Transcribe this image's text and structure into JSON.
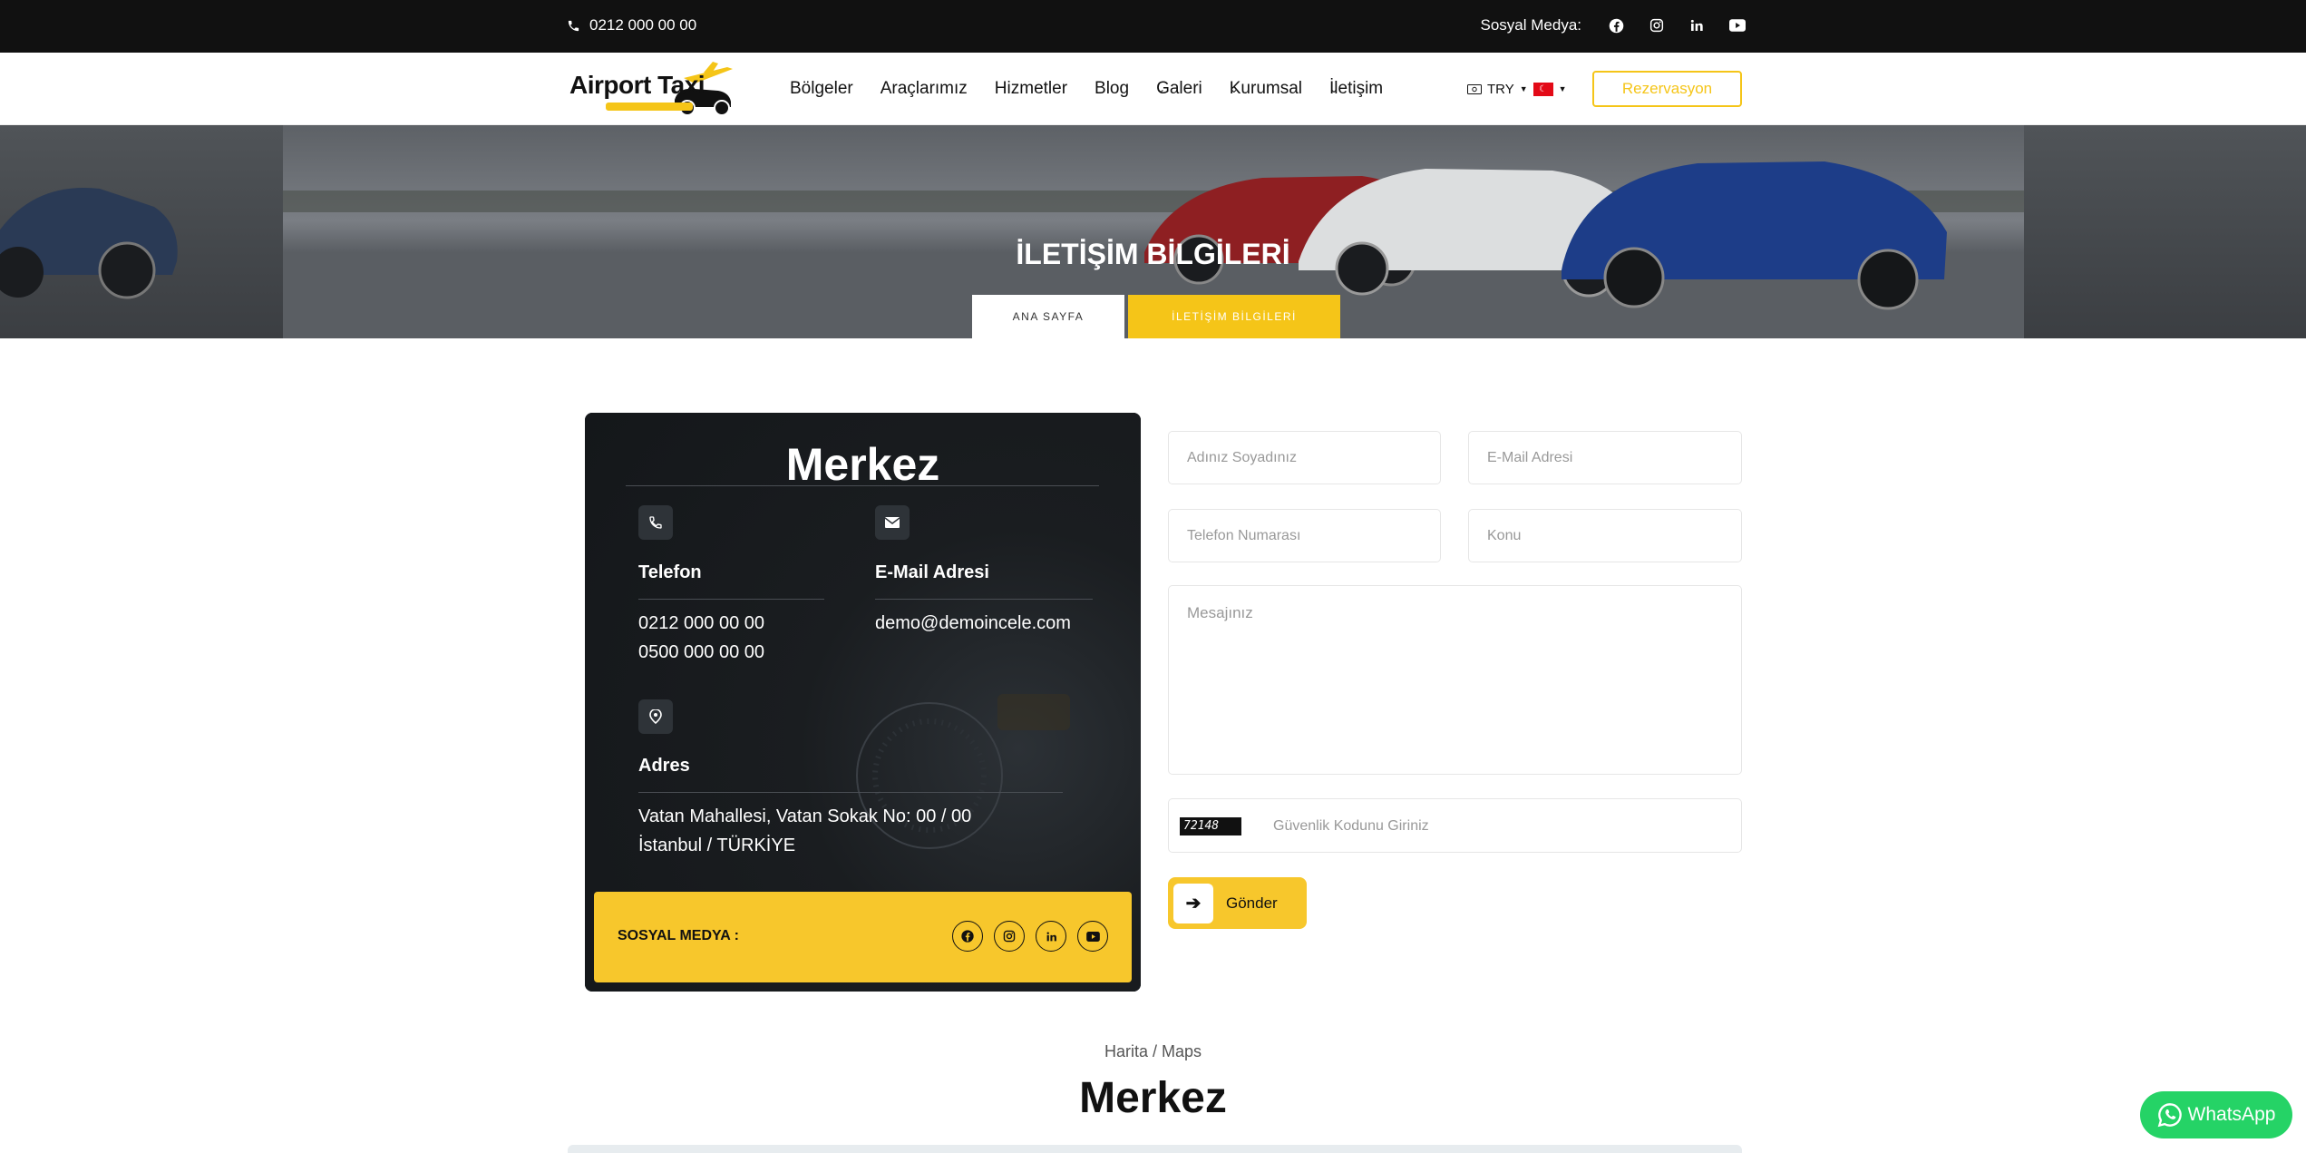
{
  "topbar": {
    "phone": "0212 000 00 00",
    "social_label": "Sosyal Medya:",
    "icons": [
      "facebook-icon",
      "instagram-icon",
      "linkedin-icon",
      "youtube-icon"
    ]
  },
  "header": {
    "logo_text": "Airport Taxi",
    "nav": [
      {
        "label": "Bölgeler"
      },
      {
        "label": "Araçlarımız"
      },
      {
        "label": "Hizmetler"
      },
      {
        "label": "Blog"
      },
      {
        "label": "Galeri"
      },
      {
        "label": "Kurumsal"
      },
      {
        "label": "İletişim"
      }
    ],
    "currency": "TRY",
    "reservation_label": "Rezervasyon"
  },
  "hero": {
    "title": "İLETİŞİM BİLGİLERİ",
    "breadcrumb_home": "ANA SAYFA",
    "breadcrumb_current": "İLETİŞİM BİLGİLERİ"
  },
  "contact_card": {
    "title": "Merkez",
    "phone_label": "Telefon",
    "phone_1": "0212 000 00 00",
    "phone_2": "0500 000 00 00",
    "email_label": "E-Mail Adresi",
    "email": "demo@demoincele.com",
    "address_label": "Adres",
    "address_1": "Vatan Mahallesi, Vatan Sokak No: 00 / 00",
    "address_2": "İstanbul / TÜRKİYE",
    "social_label": "SOSYAL MEDYA :"
  },
  "form": {
    "name_placeholder": "Adınız Soyadınız",
    "email_placeholder": "E-Mail Adresi",
    "phone_placeholder": "Telefon Numarası",
    "subject_placeholder": "Konu",
    "message_placeholder": "Mesajınız",
    "captcha_code": "72148",
    "captcha_placeholder": "Güvenlik Kodunu Giriniz",
    "submit_label": "Gönder"
  },
  "map_section": {
    "label": "Harita / Maps",
    "title": "Merkez"
  },
  "whatsapp_label": "WhatsApp",
  "colors": {
    "accent": "#f7c72c",
    "dark": "#111111",
    "whatsapp": "#25d366"
  }
}
